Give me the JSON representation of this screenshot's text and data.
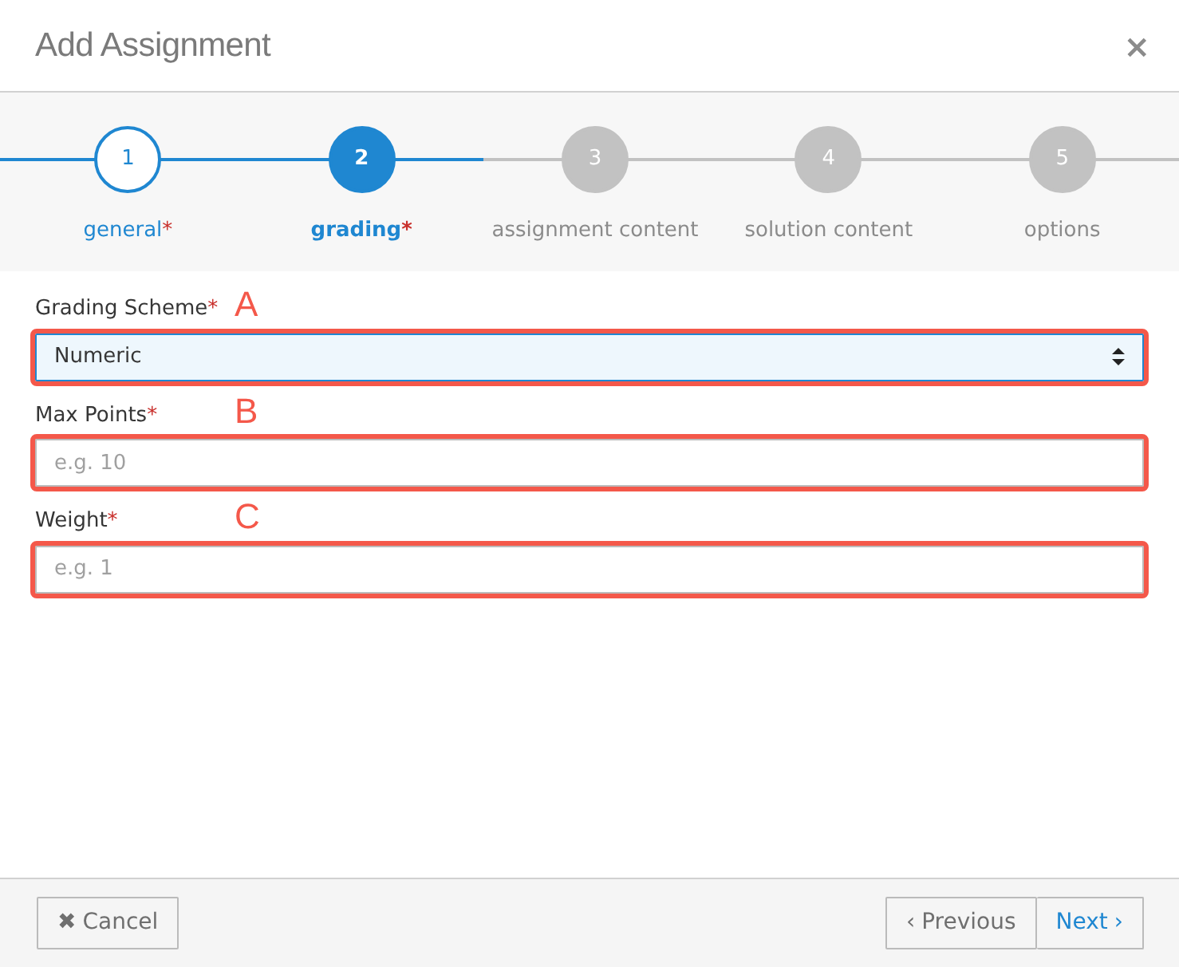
{
  "dialog": {
    "title": "Add Assignment",
    "close": "×"
  },
  "steps": [
    {
      "number": "1",
      "label": "general",
      "mark": "*",
      "completed": true,
      "selected": false
    },
    {
      "number": "2",
      "label": "grading",
      "mark": "*",
      "completed": false,
      "selected": true
    },
    {
      "number": "3",
      "label": "assignment content",
      "completed": false,
      "selected": false
    },
    {
      "number": "4",
      "label": "solution content",
      "completed": false,
      "selected": false
    },
    {
      "number": "5",
      "label": "options",
      "completed": false,
      "selected": false
    }
  ],
  "fields": [
    {
      "kind": "select",
      "label": "Grading Scheme",
      "mark": "*",
      "value": "Numeric",
      "annotation": "A"
    },
    {
      "kind": "input",
      "label": "Max Points",
      "mark": "*",
      "placeholder": "e.g. 10",
      "annotation": "B"
    },
    {
      "kind": "input",
      "label": "Weight",
      "mark": "*",
      "placeholder": "e.g. 1",
      "annotation": "C"
    }
  ],
  "footer": {
    "cancel": {
      "icon": "✖",
      "label": "Cancel"
    },
    "previous": {
      "icon": "‹",
      "label": "Previous"
    },
    "next": {
      "label": "Next",
      "icon": "›"
    }
  }
}
